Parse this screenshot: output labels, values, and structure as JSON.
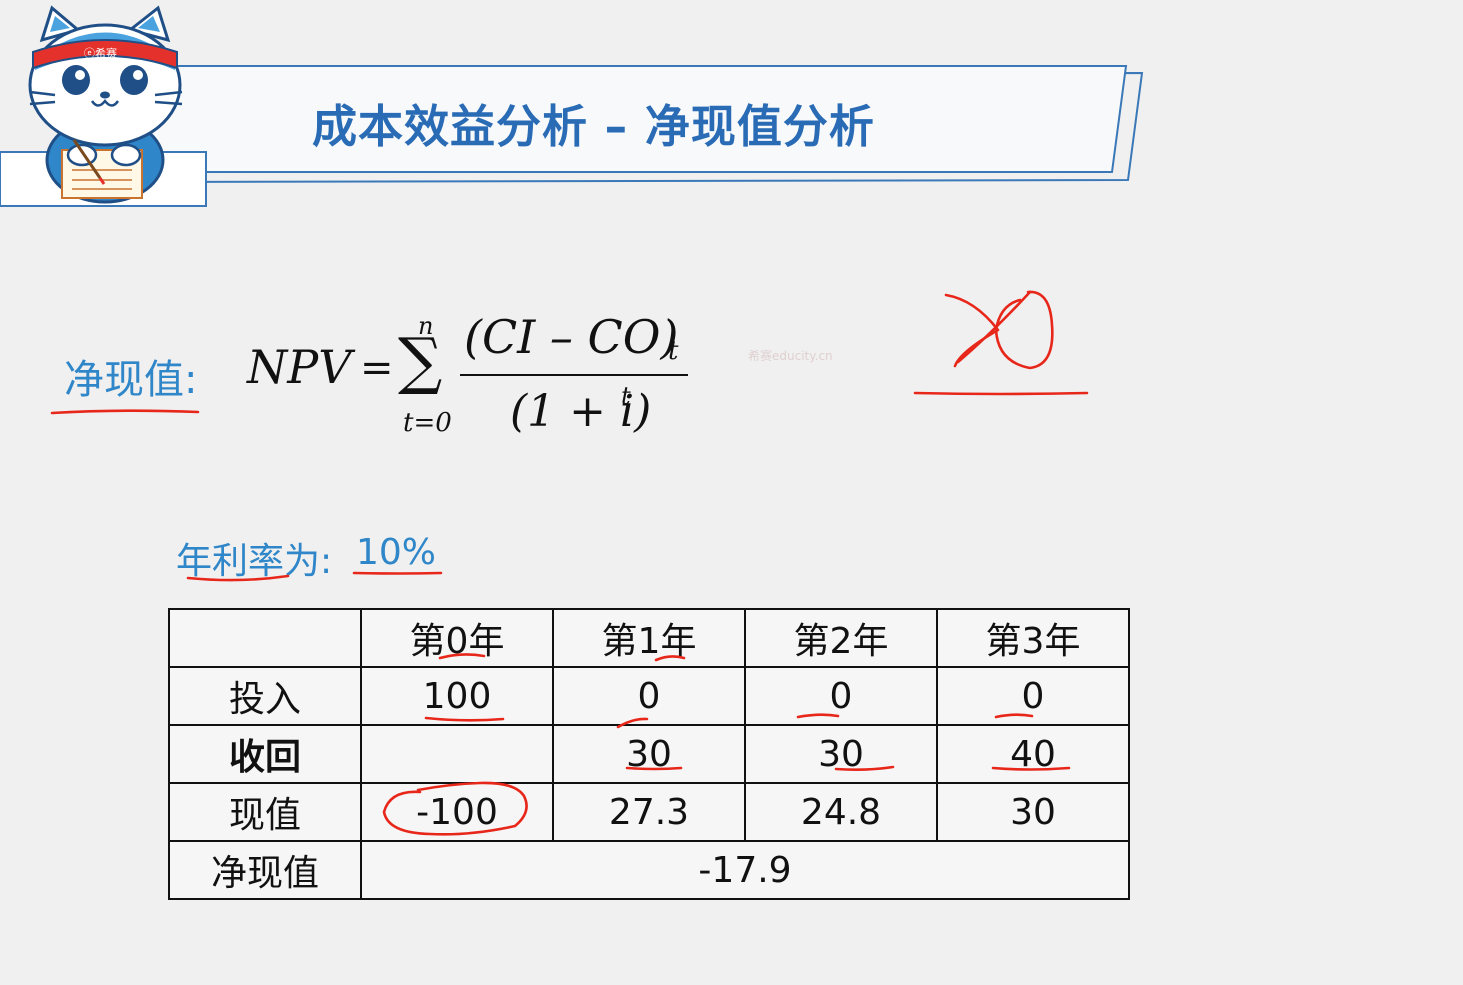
{
  "header": {
    "title": "成本效益分析 – 净现值分析",
    "mascot_badge": "希赛"
  },
  "formula": {
    "label": "净现值:",
    "lhs": "NPV",
    "equals": "=",
    "sigma": "∑",
    "upper": "n",
    "lower": "t=0",
    "numerator": "(CI – CO)",
    "numerator_sub": "t",
    "denominator": "(1 + i)",
    "denominator_sup": "t"
  },
  "watermark": "希赛educity.cn",
  "rate": {
    "label": "年利率为:",
    "value": "10%"
  },
  "table": {
    "header": [
      "",
      "第0年",
      "第1年",
      "第2年",
      "第3年"
    ],
    "rows": [
      {
        "label": "投入",
        "values": [
          "100",
          "0",
          "0",
          "0"
        ]
      },
      {
        "label": "收回",
        "values": [
          "",
          "30",
          "30",
          "40"
        ]
      },
      {
        "label": "现值",
        "values": [
          "-100",
          "27.3",
          "24.8",
          "30"
        ]
      }
    ],
    "npv_label": "净现值",
    "npv_value": "-17.9"
  },
  "colors": {
    "title": "#2a6bb5",
    "label_blue": "#2f86c8",
    "pen_red": "#e8271b",
    "banner_fill": "#f7f9fb",
    "banner_stroke": "#3a78b8"
  }
}
